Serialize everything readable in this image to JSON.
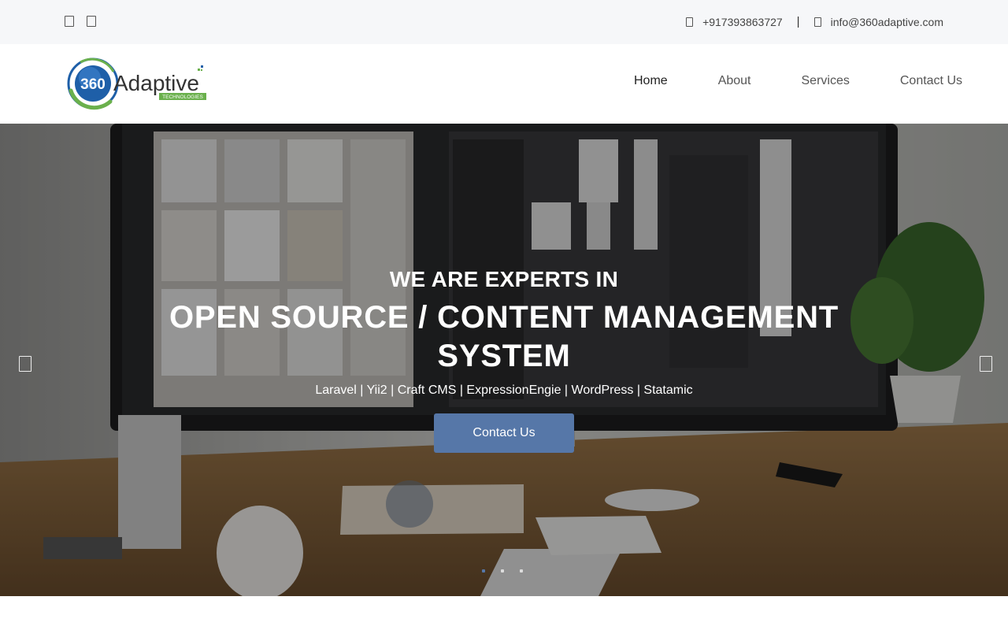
{
  "topbar": {
    "social_icons": [
      "facebook-icon",
      "twitter-icon"
    ],
    "phone": "+917393863727",
    "separator": "|",
    "email": "info@360adaptive.com"
  },
  "logo": {
    "number": "360",
    "name": "Adaptive",
    "tagline": "TECHNOLOGIES"
  },
  "nav": {
    "items": [
      {
        "label": "Home",
        "active": true
      },
      {
        "label": "About",
        "active": false
      },
      {
        "label": "Services",
        "active": false
      },
      {
        "label": "Contact Us",
        "active": false
      }
    ]
  },
  "hero": {
    "kicker": "WE ARE EXPERTS IN",
    "headline": "OPEN SOURCE / CONTENT MANAGEMENT SYSTEM",
    "tags": "Laravel | Yii2 | Craft CMS | ExpressionEngie | WordPress | Statamic",
    "cta_label": "Contact Us",
    "slides": 3,
    "active_slide": 1
  },
  "colors": {
    "accent": "#5677a8",
    "logo_green": "#6ab04c",
    "logo_blue": "#1e5fa8",
    "topbar_bg": "#f6f7f9"
  }
}
